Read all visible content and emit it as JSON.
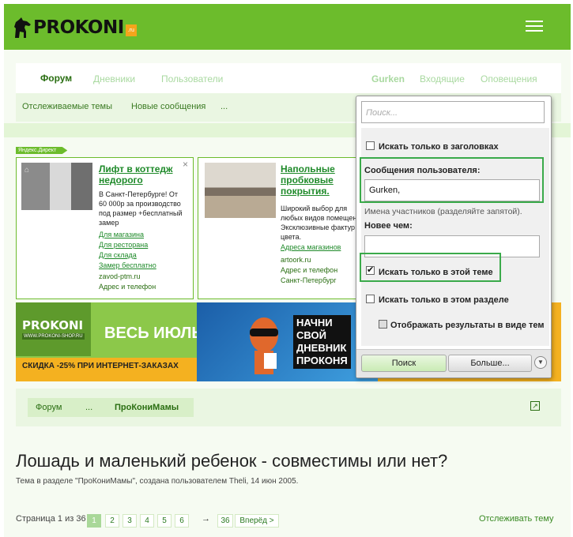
{
  "header": {
    "logo_text": "PROKONI",
    "logo_tld": ".ru",
    "brand_color": "#6cbc2c"
  },
  "nav": {
    "tabs": [
      "Форум",
      "Дневники",
      "Пользователи"
    ],
    "user": "Gurken",
    "inbox": "Входящие",
    "alerts": "Оповещения"
  },
  "subnav": {
    "items": [
      "Отслеживаемые темы",
      "Новые сообщения",
      "..."
    ]
  },
  "ads": {
    "label": "Яндекс.Директ",
    "ad1": {
      "title_line1": "Лифт в коттедж",
      "title_line2": "недорого",
      "desc": [
        "В Санкт-Петербурге! От",
        "60 000р за производство",
        "под размер +бесплатный",
        "замер"
      ],
      "links": [
        "Для магазина",
        "Для ресторана",
        "Для склада",
        "Замер бесплатно"
      ],
      "domain": "zavod-ptm.ru",
      "contact": "Адрес и телефон"
    },
    "ad2": {
      "title_line1": "Напольные",
      "title_line2": "пробковые",
      "title_line3": "покрытия.",
      "desc": [
        "Широкий выбор для",
        "любых видов помещен",
        "Эксклюзивные фактур",
        "цвета."
      ],
      "link": "Адреса магазинов",
      "domain": "artoork.ru",
      "contact": "Адрес и телефон",
      "city": "Санкт-Петербург"
    }
  },
  "banners": {
    "b1_brand": "PROKONI",
    "b1_url": "WWW.PROKONI-SHOP.RU",
    "b1_big": "ВЕСЬ ИЮЛЬ",
    "b1_sale": "СКИДКА -25% ПРИ ИНТЕРНЕТ-ЗАКАЗАХ",
    "b2_lines": [
      "НАЧНИ",
      "СВОЙ",
      "ДНЕВНИК",
      "ПРОКОНЯ"
    ]
  },
  "breadcrumb": [
    "Форум",
    "...",
    "ПроКониМамы"
  ],
  "thread": {
    "title": "Лошадь и маленький ребенок - совместимы или нет?",
    "meta": "Тема в разделе \"ПроКониМамы\", создана пользователем Theli, 14 июн 2005."
  },
  "pagination": {
    "label": "Страница 1 из 36",
    "pages": [
      "1",
      "2",
      "3",
      "4",
      "5",
      "6"
    ],
    "arrow": "→",
    "last": "36",
    "next": "Вперёд >",
    "watch": "Отслеживать тему"
  },
  "search_popup": {
    "placeholder": "Поиск...",
    "titles_only": "Искать только в заголовках",
    "titles_only_checked": false,
    "posts_by_label": "Сообщения пользователя:",
    "posts_by_value": "Gurken,",
    "posts_by_hint": "Имена участников (разделяйте запятой).",
    "newer_than_label": "Новее чем:",
    "newer_than_value": "",
    "this_thread": "Искать только в этой теме",
    "this_thread_checked": true,
    "this_forum": "Искать только в этом разделе",
    "this_forum_checked": false,
    "as_threads": "Отображать результаты в виде тем",
    "as_threads_checked": false,
    "search_button": "Поиск",
    "more_button": "Больше...",
    "highlight_color": "#3aaa4a"
  }
}
